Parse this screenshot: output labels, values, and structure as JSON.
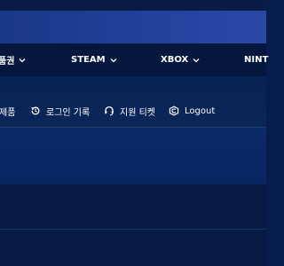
{
  "platform_nav": {
    "items": [
      {
        "label": "품권",
        "icon": "chevron-down-icon"
      },
      {
        "label": "STEAM",
        "icon": "chevron-down-icon"
      },
      {
        "label": "XBOX",
        "icon": "chevron-down-icon"
      },
      {
        "label": "NINT",
        "icon": "chevron-down-icon"
      }
    ]
  },
  "account_menu": {
    "items": [
      {
        "label": "제품",
        "icon": "none"
      },
      {
        "label": "로그인 기록",
        "icon": "history-icon"
      },
      {
        "label": "지원 티켓",
        "icon": "headset-icon"
      },
      {
        "label": "Logout",
        "icon": "logout-icon"
      }
    ]
  },
  "colors": {
    "banner": "#22419a",
    "nav_background": "#05173d",
    "page_background": "#061d4d"
  }
}
